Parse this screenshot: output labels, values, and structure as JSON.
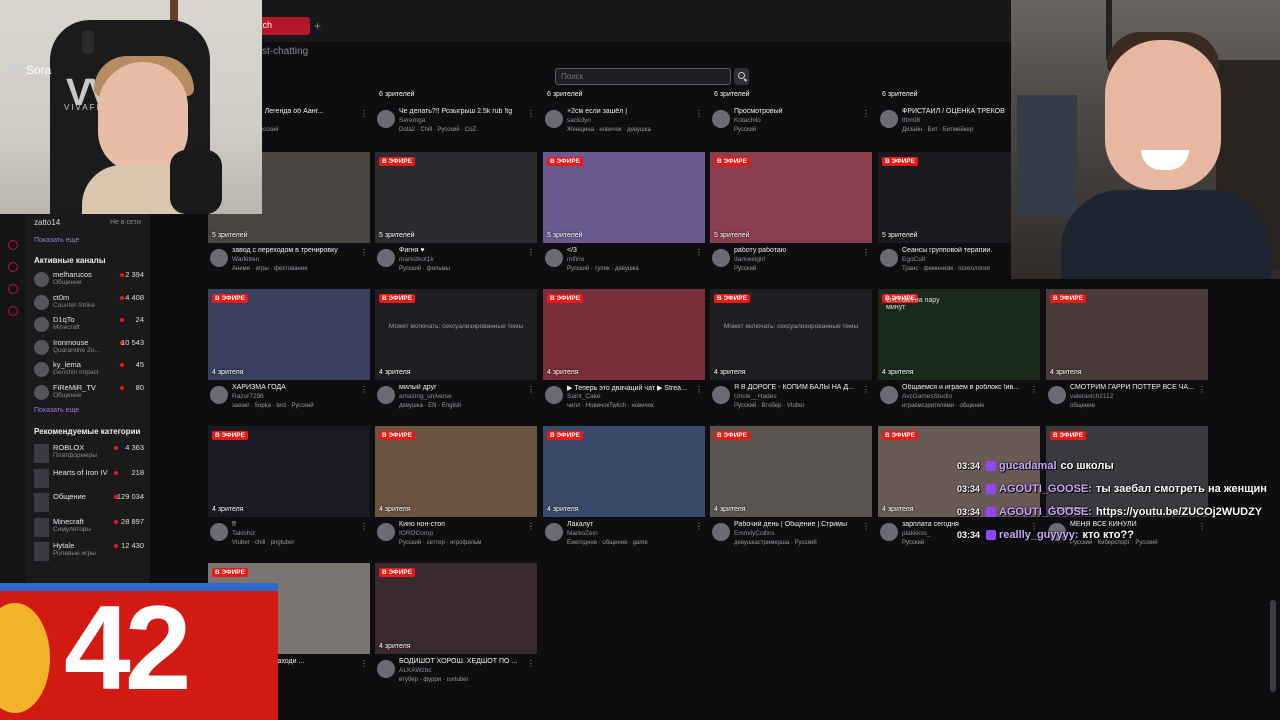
{
  "tab": {
    "label": "tch"
  },
  "breadcrumb": "st-chatting",
  "search": {
    "placeholder": "Поиск"
  },
  "cam_left": {
    "name": "Sora",
    "logo": "VV",
    "logo_sub": "VIVAFL"
  },
  "sidebar": {
    "user": {
      "name": "zatto14",
      "status": "Не в сети"
    },
    "show_more_1": "Показать еще",
    "active_header": "Активные каналы",
    "channels": [
      {
        "name": "melharucos",
        "game": "Общение",
        "viewers": "2 394"
      },
      {
        "name": "ct0m",
        "game": "Counter-Strike",
        "viewers": "4 408"
      },
      {
        "name": "D1qTo",
        "game": "Minecraft",
        "viewers": "24"
      },
      {
        "name": "Ironmouse",
        "game": "Quarantine Zo...",
        "viewers": "10 543"
      },
      {
        "name": "ky_lema",
        "game": "Genshin Impact",
        "viewers": "45"
      },
      {
        "name": "FiReMiR_TV",
        "game": "Общение",
        "viewers": "80"
      }
    ],
    "show_more_2": "Показать еще",
    "rec_header": "Рекомендуемые категории",
    "categories": [
      {
        "name": "ROBLOX",
        "sub": "Платформеры",
        "viewers": "4 363"
      },
      {
        "name": "Hearts of Iron IV",
        "sub": "",
        "viewers": "218"
      },
      {
        "name": "Общение",
        "sub": "",
        "viewers": "129 034"
      },
      {
        "name": "Minecraft",
        "sub": "Симуляторы",
        "viewers": "28 897"
      },
      {
        "name": "Hytale",
        "sub": "Ролевые игры",
        "viewers": "12 430"
      }
    ]
  },
  "live_label": "В ЭФИРЕ",
  "warn_text": "Может включать: сексуализированные темы",
  "row0": [
    {
      "viewers": "6 зрителей",
      "title": "н Аватар: Легенда об Аанг...",
      "streamer": "_M",
      "tags": "аватар · Русский"
    },
    {
      "viewers": "6 зрителей",
      "title": "Че делать?!! Розыгрыш 2.5k rub !tg",
      "streamer": "Seremga",
      "tags": "Dota2 · Chill · Русский · CoZ"
    },
    {
      "viewers": "6 зрителей",
      "title": "+2см если зашёл |",
      "streamer": "sackdyo",
      "tags": "Женщина · новичок · девушка"
    },
    {
      "viewers": "6 зрителей",
      "title": "Просмотровый",
      "streamer": "Kotachilo",
      "tags": "Русский"
    },
    {
      "viewers": "6 зрителей",
      "title": "ФРИСТАЙЛ / ОЦЕНКА ТРЕКОВ",
      "streamer": "tttm98",
      "tags": "Дизайн · Бит · Битмейкер"
    }
  ],
  "row1": [
    {
      "viewers": "5 зрителей",
      "title": "завод с переходом в тренировку",
      "streamer": "Warkitten",
      "tags": "Аниме · игры · фехтование"
    },
    {
      "viewers": "5 зрителей",
      "title": "Фигня ♥",
      "streamer": "markizkot1k",
      "tags": "Русский · фильмы"
    },
    {
      "viewers": "5 зрителей",
      "title": "</3",
      "streamer": "mlfirio",
      "tags": "Русский · тупик · девушка"
    },
    {
      "viewers": "5 зрителей",
      "title": "работу работаю",
      "streamer": "darkweigirl",
      "tags": "Русский"
    },
    {
      "viewers": "5 зрителей",
      "title": "Сеансы групповой терапии.",
      "streamer": "EgoCult",
      "tags": "Транс · феминизм · психология"
    }
  ],
  "row2": [
    {
      "viewers": "4 зрителя",
      "title": "ХАРИЗМА ГОДА",
      "streamer": "Razor7296",
      "tags": "заезеr · 5opka · test · Русский"
    },
    {
      "viewers": "4 зрителя",
      "title": "милый друг",
      "streamer": "amazing_universe",
      "tags": "девушка · EN · English"
    },
    {
      "viewers": "4 зрителя",
      "title": "▶ Теперь это двачаций чат ▶ Strea...",
      "streamer": "Saint_Cake",
      "tags": "чилл · НовичокTwitch · новичок"
    },
    {
      "viewers": "4 зрителя",
      "title": "Я В ДОРОГЕ - КОПИМ БАЛЫ НА Д...",
      "streamer": "Uncle__Hades",
      "tags": "Русский · Втобер · Vtuber"
    },
    {
      "viewers": "4 зрителя",
      "title": "Общаемся и играем в роблокс !ив...",
      "streamer": "AvcGamesStudio",
      "tags": "играемсзрителями · общение"
    },
    {
      "viewers": "4 зрителя",
      "title": "СМОТРИМ ГАРРИ ПОТТЕР ВСЕ ЧА...",
      "streamer": "valeravich2112",
      "tags": "общение"
    }
  ],
  "row2_overlay": "Отстоял на пару минут",
  "row3": [
    {
      "viewers": "4 зрителя",
      "title": "!!",
      "streamer": "Takishiz",
      "tags": "Vtuber · chill · pngtuber"
    },
    {
      "viewers": "4 зрителя",
      "title": "Кино нон-стоп",
      "streamer": "IOROComp",
      "tags": "Русский · сеттер · игрофильм"
    },
    {
      "viewers": "4 зрителя",
      "title": "Лакалут",
      "streamer": "MarkoZein",
      "tags": "Ежегодное · общение · game"
    },
    {
      "viewers": "4 зрителя",
      "title": "Рабочий день | Общение | Стримы",
      "streamer": "EmmilyCollins",
      "tags": "девушкастримерша · Русский"
    },
    {
      "viewers": "4 зрителя",
      "title": "зарплата сегодня",
      "streamer": "plakkkss_",
      "tags": "Русский"
    },
    {
      "viewers": "4 зрителя",
      "title": "МЕНЯ ВСЕ КИНУЛИ",
      "streamer": "",
      "tags": "Русский · Киберспорт · Русский"
    }
  ],
  "row4": [
    {
      "viewers": "4 зрителя",
      "title": "стримлю 31. заходи ...",
      "streamer": "",
      "tags": "usala"
    },
    {
      "viewers": "4 зрителя",
      "title": "БОДИШОТ ХОРОШ. ХЕДШОТ ПО ...",
      "streamer": "ALKAWzbc",
      "tags": "втубер · фурри · ruvtuber"
    }
  ],
  "sub_count": "42",
  "chat": [
    {
      "time": "03:34",
      "user": "gucadamal",
      "text": "со школы"
    },
    {
      "time": "03:34",
      "user": "AGOUTI_GOOSE:",
      "text": "ты заебал смотреть на женщин"
    },
    {
      "time": "03:34",
      "user": "AGOUTI_GOOSE:",
      "text": "https://youtu.be/ZUCOj2WUDZY"
    },
    {
      "time": "03:34",
      "user": "reallly_guyyyy:",
      "text": "кто кто??"
    }
  ],
  "colors": {
    "accent": "#e91916",
    "tab": "#b4162a",
    "bg": "#0e0e10",
    "purple": "#9147ff"
  }
}
